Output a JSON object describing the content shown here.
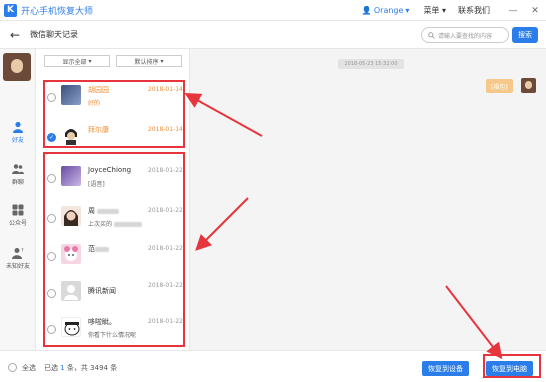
{
  "window": {
    "logo_letter": "K",
    "title": "开心手机恢复大师",
    "user": "Orange",
    "menu": "菜单",
    "contact_us": "联系我们",
    "minimize": "—",
    "close": "✕"
  },
  "header": {
    "back": "←",
    "title": "微信聊天记录",
    "search_placeholder": "请输入要查找的内容",
    "search_button": "搜索"
  },
  "nav": {
    "items": [
      {
        "label": "好友",
        "icon": "person-icon",
        "active": true
      },
      {
        "label": "群聊",
        "icon": "group-icon",
        "active": false
      },
      {
        "label": "公众号",
        "icon": "grid-icon",
        "active": false
      },
      {
        "label": "未知好友",
        "icon": "unknown-friend-icon",
        "active": false
      }
    ]
  },
  "list": {
    "filter": "显示全部",
    "sort": "默认排序",
    "contacts": [
      {
        "name": "胡园园",
        "message": "好的",
        "date": "2018-01-14",
        "selected": true,
        "checked": false
      },
      {
        "name": "拜尔康",
        "message": "",
        "date": "2018-01-14",
        "selected": true,
        "checked": true
      },
      {
        "name": "JoyceChiong",
        "message": "[语音]",
        "date": "2018-01-22",
        "selected": false,
        "checked": false
      },
      {
        "name": "周",
        "message": "上次买的",
        "date": "2018-01-22",
        "selected": false,
        "checked": false
      },
      {
        "name": "范",
        "message": "",
        "date": "2018-01-22",
        "selected": false,
        "checked": false
      },
      {
        "name": "腾讯新闻",
        "message": "",
        "date": "2018-01-22",
        "selected": false,
        "checked": false
      },
      {
        "name": "哆啦眦。",
        "message": "你看下什么情况呢",
        "date": "2018-01-22",
        "selected": false,
        "checked": false
      }
    ]
  },
  "chat": {
    "timestamp": "2018-05-23 15:32:00",
    "bubble": "[福包]"
  },
  "footer": {
    "select_all": "全选",
    "status_prefix": "已选 ",
    "selected_count": "1",
    "status_mid": " 条，共 ",
    "total_count": "3494",
    "status_suffix": " 条",
    "restore_device": "恢复到设备",
    "restore_pc": "恢复到电脑"
  },
  "colors": {
    "accent": "#2b7de9",
    "selected_text": "#f08c2e",
    "annotation": "#e8343c"
  }
}
